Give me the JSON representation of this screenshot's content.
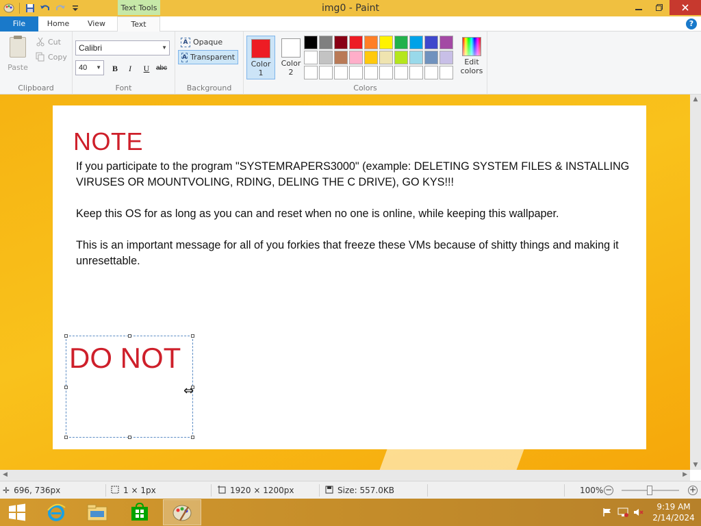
{
  "window": {
    "title": "img0 - Paint",
    "contextual_tab": "Text Tools",
    "minimize_icon": "minimize-icon",
    "maximize_icon": "restore-icon",
    "close_icon": "close-icon"
  },
  "quick_access": {
    "icons": [
      "paint-app-icon",
      "save-icon",
      "undo-icon",
      "redo-icon",
      "customize-qat-icon"
    ]
  },
  "tabs": {
    "file": "File",
    "home": "Home",
    "view": "View",
    "text": "Text",
    "help": "?"
  },
  "clipboard": {
    "label": "Clipboard",
    "paste": "Paste",
    "cut": "Cut",
    "copy": "Copy"
  },
  "font": {
    "label": "Font",
    "family": "Calibri",
    "size": "40",
    "bold": "B",
    "italic": "I",
    "underline": "U",
    "strikethrough": "abc"
  },
  "background": {
    "label": "Background",
    "opaque": "Opaque",
    "transparent": "Transparent",
    "selected": "transparent"
  },
  "colors": {
    "label": "Colors",
    "color1_label_line1": "Color",
    "color1_label_line2": "1",
    "color2_label_line1": "Color",
    "color2_label_line2": "2",
    "edit_label_line1": "Edit",
    "edit_label_line2": "colors",
    "color1_value": "#ed1c24",
    "color2_value": "#ffffff",
    "palette_row1": [
      "#000000",
      "#7f7f7f",
      "#880015",
      "#ed1c24",
      "#ff7f27",
      "#fff200",
      "#22b14c",
      "#00a2e8",
      "#3f48cc",
      "#a349a4"
    ],
    "palette_row2": [
      "#ffffff",
      "#c3c3c3",
      "#b97a57",
      "#ffaec9",
      "#ffc90e",
      "#efe4b0",
      "#b5e61d",
      "#99d9ea",
      "#7092be",
      "#c8bfe7"
    ],
    "palette_row3": [
      "#ffffff",
      "#ffffff",
      "#ffffff",
      "#ffffff",
      "#ffffff",
      "#ffffff",
      "#ffffff",
      "#ffffff",
      "#ffffff",
      "#ffffff"
    ]
  },
  "canvas": {
    "heading": "NOTE",
    "para1": "If you participate to the program \"SYSTEMRAPERS3000\" (example: DELETING SYSTEM FILES & INSTALLING VIRUSES OR MOUNTVOLING, RDING, DELING THE C DRIVE), GO KYS!!!",
    "para2": "Keep this OS for as long as you can and reset when no one is online, while keeping this wallpaper.",
    "para3": "This is an important message for all of you forkies that freeze these VMs because of shitty things and making it unresettable.",
    "textbox_content": "DO NOT",
    "accent_color": "#ce1f2a"
  },
  "status": {
    "cursor_pos": "696, 736px",
    "selection_size": "1 × 1px",
    "image_size": "1920 × 1200px",
    "file_size": "Size: 557.0KB",
    "zoom": "100%"
  },
  "taskbar": {
    "apps": [
      "start-button",
      "internet-explorer-icon",
      "file-explorer-icon",
      "store-icon",
      "paint-icon"
    ],
    "time": "9:19 AM",
    "date": "2/14/2024"
  }
}
